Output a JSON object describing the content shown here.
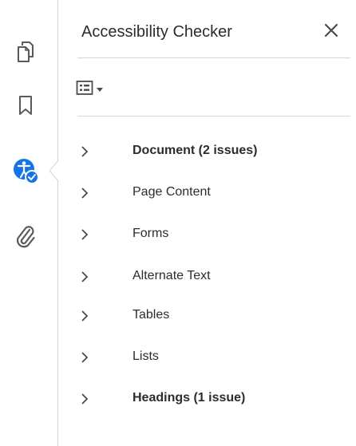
{
  "rail": {
    "tools": [
      {
        "name": "pages-icon"
      },
      {
        "name": "bookmark-icon"
      },
      {
        "name": "accessibility-checker-icon",
        "active": true
      },
      {
        "name": "attachment-icon"
      }
    ]
  },
  "panel": {
    "title": "Accessibility Checker",
    "close_icon": "close-icon",
    "options_icon": "list-options-icon"
  },
  "categories": [
    {
      "label": "Document (2 issues)",
      "bold": true
    },
    {
      "label": "Page Content",
      "bold": false
    },
    {
      "label": "Forms",
      "bold": false
    },
    {
      "label": "Alternate Text",
      "bold": false
    },
    {
      "label": "Tables",
      "bold": false
    },
    {
      "label": "Lists",
      "bold": false
    },
    {
      "label": "Headings (1 issue)",
      "bold": true
    }
  ],
  "colors": {
    "text": "#2c2c2c",
    "icon_gray": "#5a5a5a",
    "accent_blue": "#1473e6",
    "divider": "#d6d6d6"
  }
}
